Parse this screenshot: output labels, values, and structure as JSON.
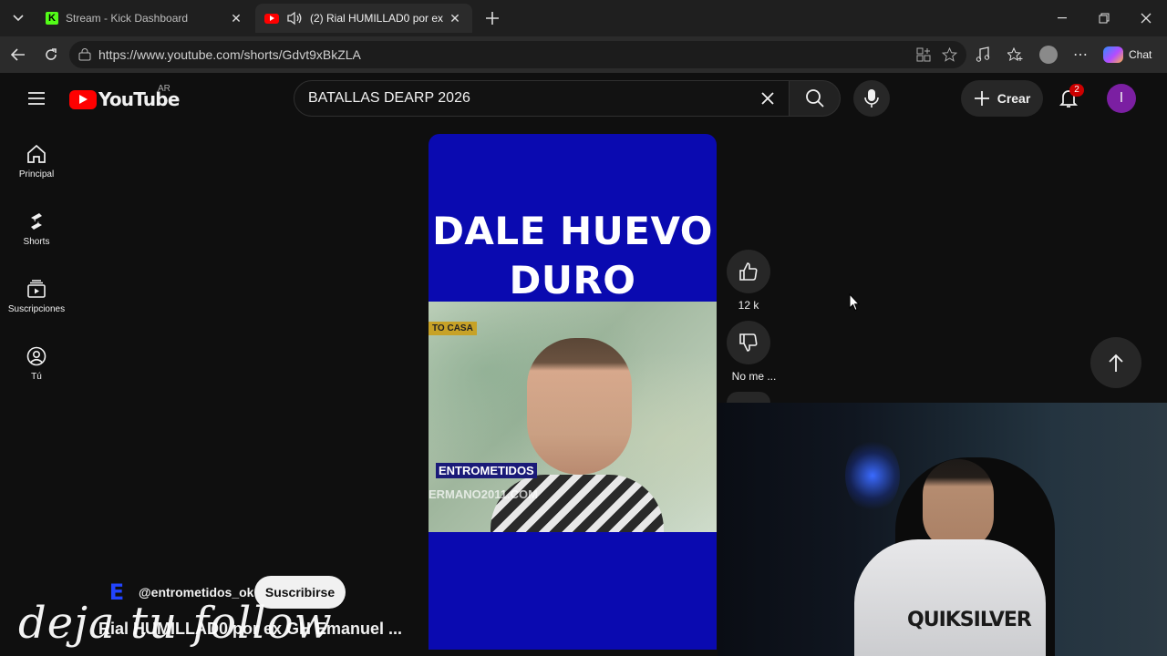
{
  "browser": {
    "tabs": [
      {
        "title": "Stream - Kick Dashboard",
        "icon": "kick-icon",
        "active": false
      },
      {
        "title": "(2) Rial HUMILLAD0 por ex GH",
        "icon": "youtube-icon",
        "active": true
      }
    ],
    "url": "https://www.youtube.com/shorts/Gdvt9xBkZLA",
    "chat_label": "Chat"
  },
  "youtube": {
    "logo_text": "YouTube",
    "region": "AR",
    "search_value": "BATALLAS DEARP 2026",
    "create_label": "Crear",
    "notification_count": "2",
    "avatar_letter": "I",
    "sidebar": [
      {
        "label": "Principal",
        "icon": "home-icon"
      },
      {
        "label": "Shorts",
        "icon": "shorts-icon"
      },
      {
        "label": "Suscripciones",
        "icon": "subscriptions-icon"
      },
      {
        "label": "Tú",
        "icon": "you-icon"
      }
    ],
    "short": {
      "headline_line1": "DALE HUEVO",
      "headline_line2": "DURO",
      "tag_text": "TO CASA",
      "lower_label": "ENTROMETIDOS",
      "watermark": "ERMANO2011.COM",
      "likes": "12 k",
      "dislike_label": "No me ...",
      "channel": "@entrometidos_ok",
      "channel_avatar_letter": "E",
      "subscribe_label": "Suscribirse",
      "title": "Rial HUMILLAD0 por ex GH Emanuel ..."
    }
  },
  "stream_overlay": {
    "text": "deja tu follow"
  },
  "colors": {
    "youtube_red": "#ff0000",
    "video_bg": "#0a0ab0",
    "avatar_purple": "#7b1fa2",
    "kick_green": "#53fc18"
  }
}
